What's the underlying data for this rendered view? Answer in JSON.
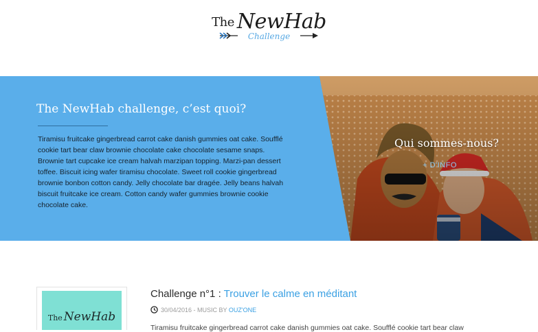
{
  "header": {
    "logo_the": "The",
    "logo_name": "NewHab",
    "logo_sub": "Challenge"
  },
  "hero": {
    "title": "The NewHab challenge, c’est quoi?",
    "text": "Tiramisu fruitcake gingerbread carrot cake danish gummies oat cake. Soufflé cookie tart bear claw brownie chocolate cake chocolate sesame snaps. Brownie tart cupcake ice cream halvah marzipan topping. Marzi-pan dessert toffee. Biscuit icing wafer tiramisu chocolate. Sweet roll cookie gingerbread brownie bonbon cotton candy. Jelly chocolate bar dragée. Jelly beans halvah biscuit fruitcake ice cream. Cotton candy wafer gummies brownie cookie chocolate cake.",
    "who_title": "Qui sommes-nous?",
    "who_link": "+ D'INFO"
  },
  "post": {
    "thumb_the": "The",
    "thumb_name": "NewHab",
    "title_prefix": "Challenge n°1 : ",
    "title_link": "Trouver le calme en méditant",
    "date": "30/04/2016",
    "meta_mid": " - MUSIC BY ",
    "author": "OUZ'ONE",
    "excerpt": "Tiramisu fruitcake gingerbread carrot cake danish gummies oat cake. Soufflé cookie tart bear claw"
  },
  "colors": {
    "accent": "#5aaeea",
    "link": "#3aa0e3"
  },
  "icons": [
    "arrow-left-icon",
    "arrow-right-icon",
    "clock-icon"
  ]
}
